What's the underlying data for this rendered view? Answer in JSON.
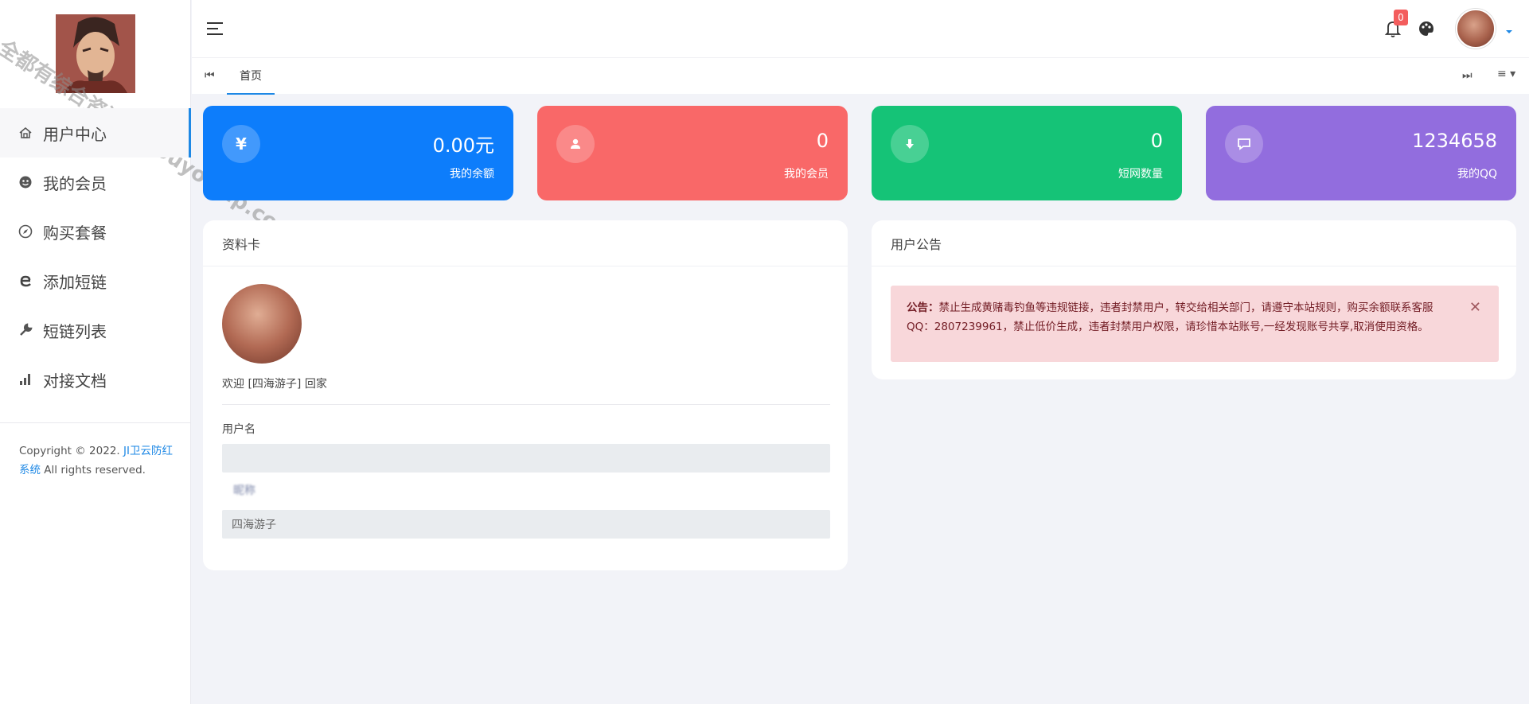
{
  "sidebar": {
    "watermark": "全都有综合资源网 douyouvip.com",
    "items": [
      {
        "label": "用户中心",
        "icon": "home-icon",
        "active": true
      },
      {
        "label": "我的会员",
        "icon": "smiley-icon",
        "active": false
      },
      {
        "label": "购买套餐",
        "icon": "compass-icon",
        "active": false
      },
      {
        "label": "添加短链",
        "icon": "edge-icon",
        "active": false
      },
      {
        "label": "短链列表",
        "icon": "wrench-icon",
        "active": false
      },
      {
        "label": "对接文档",
        "icon": "bar-chart-icon",
        "active": false
      }
    ],
    "copyright_prefix": "Copyright © 2022. ",
    "copyright_link": "JI卫云防红系统",
    "copyright_suffix": " All rights reserved."
  },
  "header": {
    "notification_count": "0",
    "menu_icon": "hamburger-icon",
    "bell_icon": "bell-icon",
    "theme_icon": "palette-icon"
  },
  "tabs": {
    "home_label": "首页",
    "prev_icon": "first-page-icon",
    "next_icon": "last-page-icon",
    "menu_icon": "tab-menu-icon"
  },
  "stats": [
    {
      "value": "0.00元",
      "label": "我的余额",
      "icon_glyph": "¥",
      "color": "#0d7dfb"
    },
    {
      "value": "0",
      "label": "我的会员",
      "icon_glyph": "user-icon",
      "color": "#f96868"
    },
    {
      "value": "0",
      "label": "短网数量",
      "icon_glyph": "download-icon",
      "color": "#15c377"
    },
    {
      "value": "1234658",
      "label": "我的QQ",
      "icon_glyph": "chat-icon",
      "color": "#926dde"
    }
  ],
  "profile": {
    "title": "资料卡",
    "welcome": "欢迎 [四海游子] 回家",
    "username_label": "用户名",
    "username_value": "",
    "nickname_label": "昵称",
    "nickname_value": "四海游子"
  },
  "announcement": {
    "title": "用户公告",
    "prefix": "公告：",
    "text": "禁止生成黄赌毒钓鱼等违规链接，违者封禁用户，转交给相关部门，请遵守本站规则，购买余额联系客服QQ：2807239961，禁止低价生成，违者封禁用户权限，请珍惜本站账号,一经发现账号共享,取消使用资格。",
    "close_icon": "close-icon"
  }
}
